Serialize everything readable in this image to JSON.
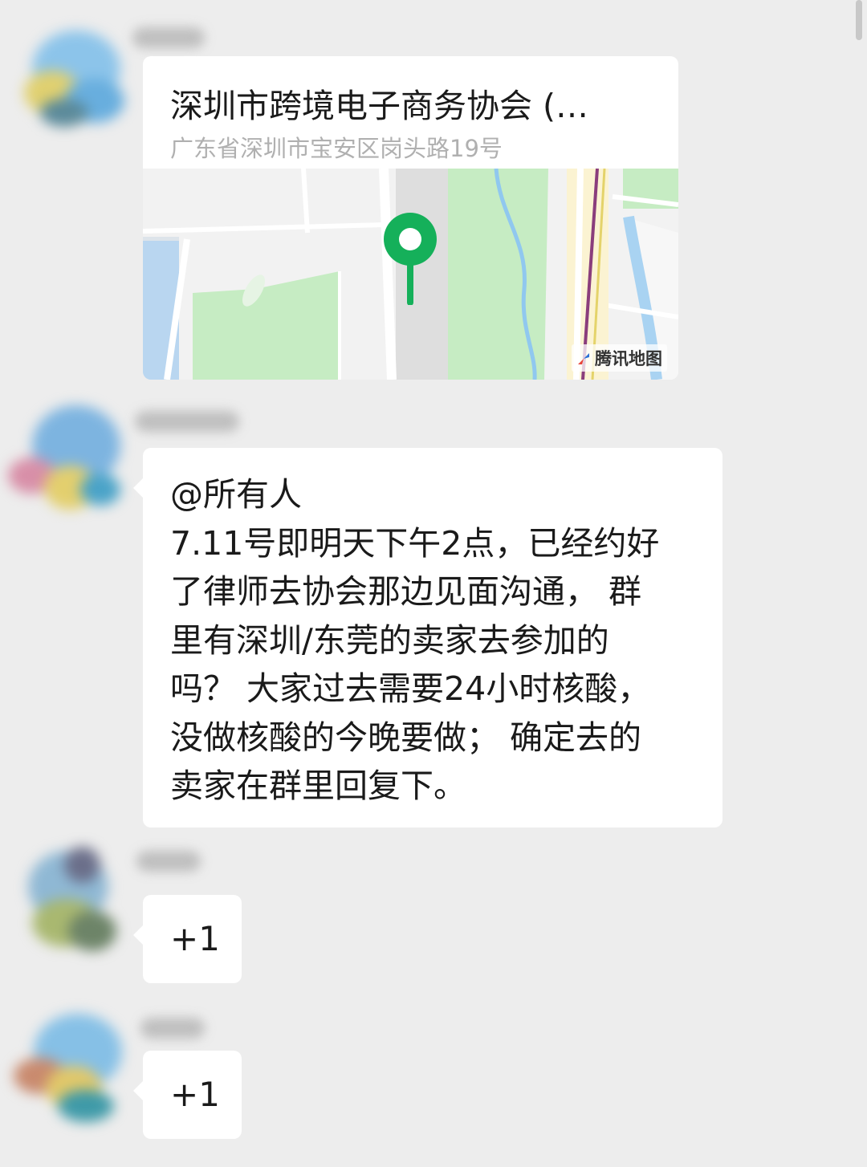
{
  "messages": [
    {
      "type": "location",
      "title": "深圳市跨境电子商务协会 (…",
      "address": "广东省深圳市宝安区岗头路19号",
      "map_attribution": "腾讯地图"
    },
    {
      "type": "text",
      "lines": [
        "@所有人",
        "7.11号即明天下午2点，已经约好",
        "了律师去协会那边见面沟通， 群",
        "里有深圳/东莞的卖家去参加的",
        "吗？ 大家过去需要24小时核酸，",
        "没做核酸的今晚要做； 确定去的",
        "卖家在群里回复下。"
      ]
    },
    {
      "type": "text",
      "text": "+1"
    },
    {
      "type": "text",
      "text": "+1"
    }
  ],
  "colors": {
    "chat_background": "#ededed",
    "bubble": "#ffffff",
    "map_pin": "#15b05a",
    "map_green": "#c6ecc3",
    "map_water": "#a9d3f2"
  }
}
